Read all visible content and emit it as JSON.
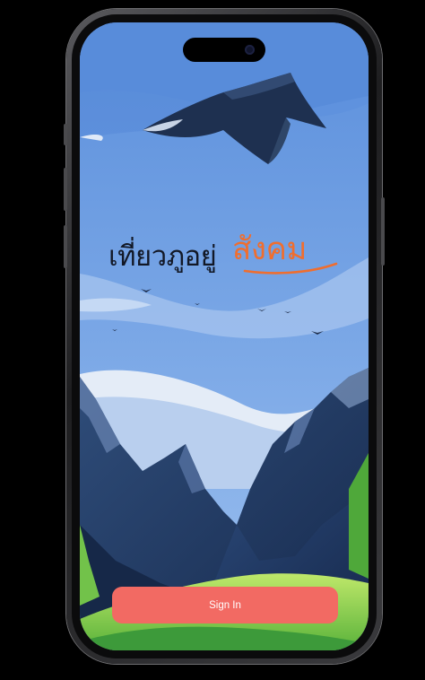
{
  "logo": {
    "text_dark": "เที่ยวภูอยู่",
    "text_accent": "สังคม"
  },
  "actions": {
    "sign_in_label": "Sign In"
  },
  "colors": {
    "accent": "#ef6e2f",
    "button": "#f26a63",
    "sky": "#7aa7e6"
  }
}
